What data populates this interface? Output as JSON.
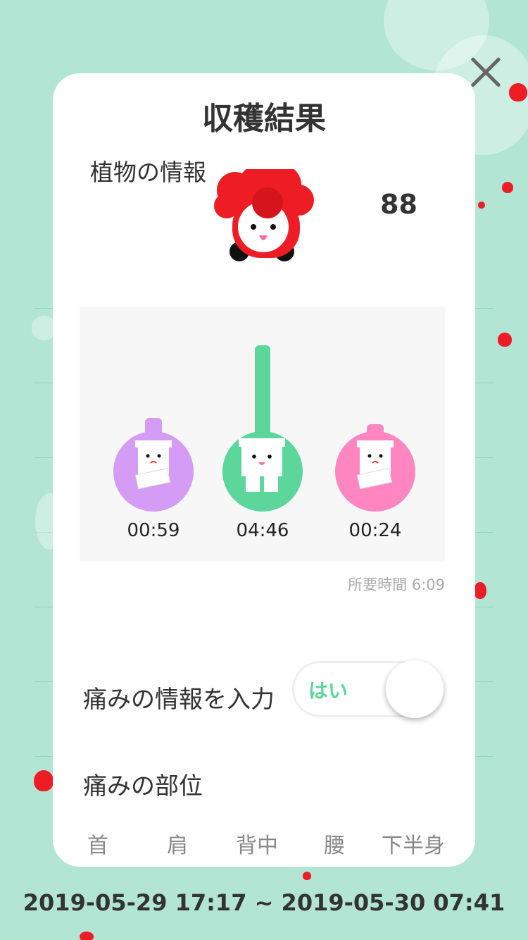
{
  "header": {
    "title": "収穫結果"
  },
  "plant_info": {
    "label": "植物の情報",
    "score": "88"
  },
  "chart": {
    "colors": {
      "purple": "#d59cf5",
      "green": "#5cd69a",
      "pink": "#ff86c0"
    },
    "items": [
      {
        "time": "00:59",
        "color_name": "purple"
      },
      {
        "time": "04:46",
        "color_name": "green"
      },
      {
        "time": "00:24",
        "color_name": "pink"
      }
    ],
    "duration_label": "所要時間 6:09"
  },
  "pain_input": {
    "label": "痛みの情報を入力",
    "toggle_text": "はい"
  },
  "pain_area": {
    "label": "痛みの部位",
    "items": [
      "首",
      "肩",
      "背中",
      "腰",
      "下半身"
    ]
  },
  "footer": {
    "date_range": "2019-05-29 17:17 ~ 2019-05-30 07:41"
  }
}
